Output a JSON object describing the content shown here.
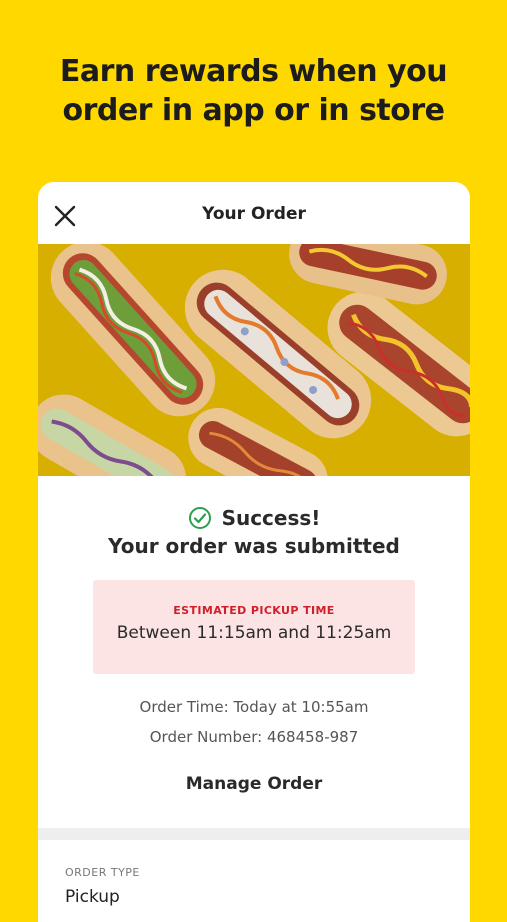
{
  "promo": {
    "line1": "Earn rewards when you",
    "line2": "order in app or in store"
  },
  "header": {
    "title": "Your Order",
    "close_icon": "close-icon"
  },
  "confirmation": {
    "status": "Success!",
    "message": "Your order was submitted",
    "status_icon": "check-circle-icon",
    "status_color": "#2E9E4F"
  },
  "pickup": {
    "label": "ESTIMATED PICKUP TIME",
    "time": "Between 11:15am and 11:25am",
    "label_color": "#D01F2A",
    "background": "#FCE4E4"
  },
  "details": {
    "order_time": "Order Time: Today at 10:55am",
    "order_number": "Order Number: 468458-987"
  },
  "actions": {
    "manage": "Manage Order"
  },
  "order_type": {
    "label": "ORDER TYPE",
    "value": "Pickup"
  },
  "colors": {
    "brand_yellow": "#FFD800"
  }
}
